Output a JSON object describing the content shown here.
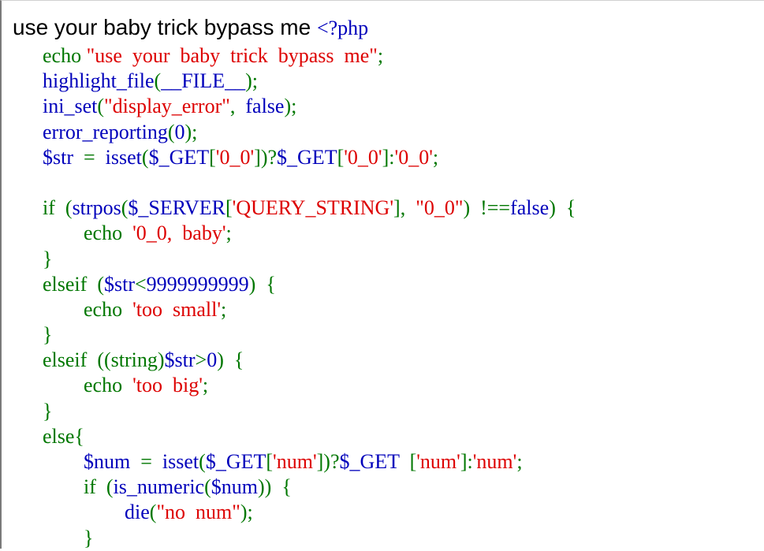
{
  "page": {
    "headline_text": "use your baby trick bypass me ",
    "open_tag": "<?php"
  },
  "code_lines": [
    [
      {
        "t": "        "
      },
      {
        "t": "echo",
        "c": "green"
      },
      {
        "t": " ",
        "c": "green"
      },
      {
        "t": "\"use  your  baby  trick  bypass  me\"",
        "c": "red"
      },
      {
        "t": ";",
        "c": "green"
      }
    ],
    [
      {
        "t": "        "
      },
      {
        "t": "highlight_file",
        "c": "blue"
      },
      {
        "t": "(",
        "c": "green"
      },
      {
        "t": "__FILE__",
        "c": "blue"
      },
      {
        "t": ");",
        "c": "green"
      }
    ],
    [
      {
        "t": "        "
      },
      {
        "t": "ini_set",
        "c": "blue"
      },
      {
        "t": "(",
        "c": "green"
      },
      {
        "t": "\"display_error\"",
        "c": "red"
      },
      {
        "t": ",  ",
        "c": "green"
      },
      {
        "t": "false",
        "c": "blue"
      },
      {
        "t": ");",
        "c": "green"
      }
    ],
    [
      {
        "t": "        "
      },
      {
        "t": "error_reporting",
        "c": "blue"
      },
      {
        "t": "(",
        "c": "green"
      },
      {
        "t": "0",
        "c": "blue"
      },
      {
        "t": ");",
        "c": "green"
      }
    ],
    [
      {
        "t": "        "
      },
      {
        "t": "$str",
        "c": "blue"
      },
      {
        "t": "  =  ",
        "c": "green"
      },
      {
        "t": "isset",
        "c": "blue"
      },
      {
        "t": "(",
        "c": "green"
      },
      {
        "t": "$_GET",
        "c": "blue"
      },
      {
        "t": "[",
        "c": "green"
      },
      {
        "t": "'0_0'",
        "c": "red"
      },
      {
        "t": "])?",
        "c": "green"
      },
      {
        "t": "$_GET",
        "c": "blue"
      },
      {
        "t": "[",
        "c": "green"
      },
      {
        "t": "'0_0'",
        "c": "red"
      },
      {
        "t": "]:",
        "c": "green"
      },
      {
        "t": "'0_0'",
        "c": "red"
      },
      {
        "t": ";",
        "c": "green"
      }
    ],
    [
      {
        "t": " "
      }
    ],
    [
      {
        "t": "        "
      },
      {
        "t": "if",
        "c": "green"
      },
      {
        "t": "  (",
        "c": "green"
      },
      {
        "t": "strpos",
        "c": "blue"
      },
      {
        "t": "(",
        "c": "green"
      },
      {
        "t": "$_SERVER",
        "c": "blue"
      },
      {
        "t": "[",
        "c": "green"
      },
      {
        "t": "'QUERY_STRING'",
        "c": "red"
      },
      {
        "t": "],  ",
        "c": "green"
      },
      {
        "t": "\"0_0\"",
        "c": "red"
      },
      {
        "t": ")  !==",
        "c": "green"
      },
      {
        "t": "false",
        "c": "blue"
      },
      {
        "t": ")  {",
        "c": "green"
      }
    ],
    [
      {
        "t": "                "
      },
      {
        "t": "echo",
        "c": "green"
      },
      {
        "t": "  ",
        "c": "green"
      },
      {
        "t": "'0_0,  baby'",
        "c": "red"
      },
      {
        "t": ";",
        "c": "green"
      }
    ],
    [
      {
        "t": "        "
      },
      {
        "t": "}",
        "c": "green"
      }
    ],
    [
      {
        "t": "        "
      },
      {
        "t": "elseif",
        "c": "green"
      },
      {
        "t": "  (",
        "c": "green"
      },
      {
        "t": "$str",
        "c": "blue"
      },
      {
        "t": "<",
        "c": "green"
      },
      {
        "t": "9999999999",
        "c": "blue"
      },
      {
        "t": ")  {",
        "c": "green"
      }
    ],
    [
      {
        "t": "                "
      },
      {
        "t": "echo",
        "c": "green"
      },
      {
        "t": "  ",
        "c": "green"
      },
      {
        "t": "'too  small'",
        "c": "red"
      },
      {
        "t": ";",
        "c": "green"
      }
    ],
    [
      {
        "t": "        "
      },
      {
        "t": "}",
        "c": "green"
      }
    ],
    [
      {
        "t": "        "
      },
      {
        "t": "elseif",
        "c": "green"
      },
      {
        "t": "  ((string)",
        "c": "green"
      },
      {
        "t": "$str",
        "c": "blue"
      },
      {
        "t": ">",
        "c": "green"
      },
      {
        "t": "0",
        "c": "blue"
      },
      {
        "t": ")  {",
        "c": "green"
      }
    ],
    [
      {
        "t": "                "
      },
      {
        "t": "echo",
        "c": "green"
      },
      {
        "t": "  ",
        "c": "green"
      },
      {
        "t": "'too  big'",
        "c": "red"
      },
      {
        "t": ";",
        "c": "green"
      }
    ],
    [
      {
        "t": "        "
      },
      {
        "t": "}",
        "c": "green"
      }
    ],
    [
      {
        "t": "        "
      },
      {
        "t": "else{",
        "c": "green"
      }
    ],
    [
      {
        "t": "                "
      },
      {
        "t": "$num",
        "c": "blue"
      },
      {
        "t": "  =  ",
        "c": "green"
      },
      {
        "t": "isset",
        "c": "blue"
      },
      {
        "t": "(",
        "c": "green"
      },
      {
        "t": "$_GET",
        "c": "blue"
      },
      {
        "t": "[",
        "c": "green"
      },
      {
        "t": "'num'",
        "c": "red"
      },
      {
        "t": "])?",
        "c": "green"
      },
      {
        "t": "$_GET",
        "c": "blue"
      },
      {
        "t": "  [",
        "c": "green"
      },
      {
        "t": "'num'",
        "c": "red"
      },
      {
        "t": "]:",
        "c": "green"
      },
      {
        "t": "'num'",
        "c": "red"
      },
      {
        "t": ";",
        "c": "green"
      }
    ],
    [
      {
        "t": "                "
      },
      {
        "t": "if",
        "c": "green"
      },
      {
        "t": "  (",
        "c": "green"
      },
      {
        "t": "is_numeric",
        "c": "blue"
      },
      {
        "t": "(",
        "c": "green"
      },
      {
        "t": "$num",
        "c": "blue"
      },
      {
        "t": "))  {",
        "c": "green"
      }
    ],
    [
      {
        "t": "                        "
      },
      {
        "t": "die",
        "c": "blue"
      },
      {
        "t": "(",
        "c": "green"
      },
      {
        "t": "\"no  num\"",
        "c": "red"
      },
      {
        "t": ");",
        "c": "green"
      }
    ],
    [
      {
        "t": "                "
      },
      {
        "t": "}",
        "c": "green"
      }
    ]
  ]
}
